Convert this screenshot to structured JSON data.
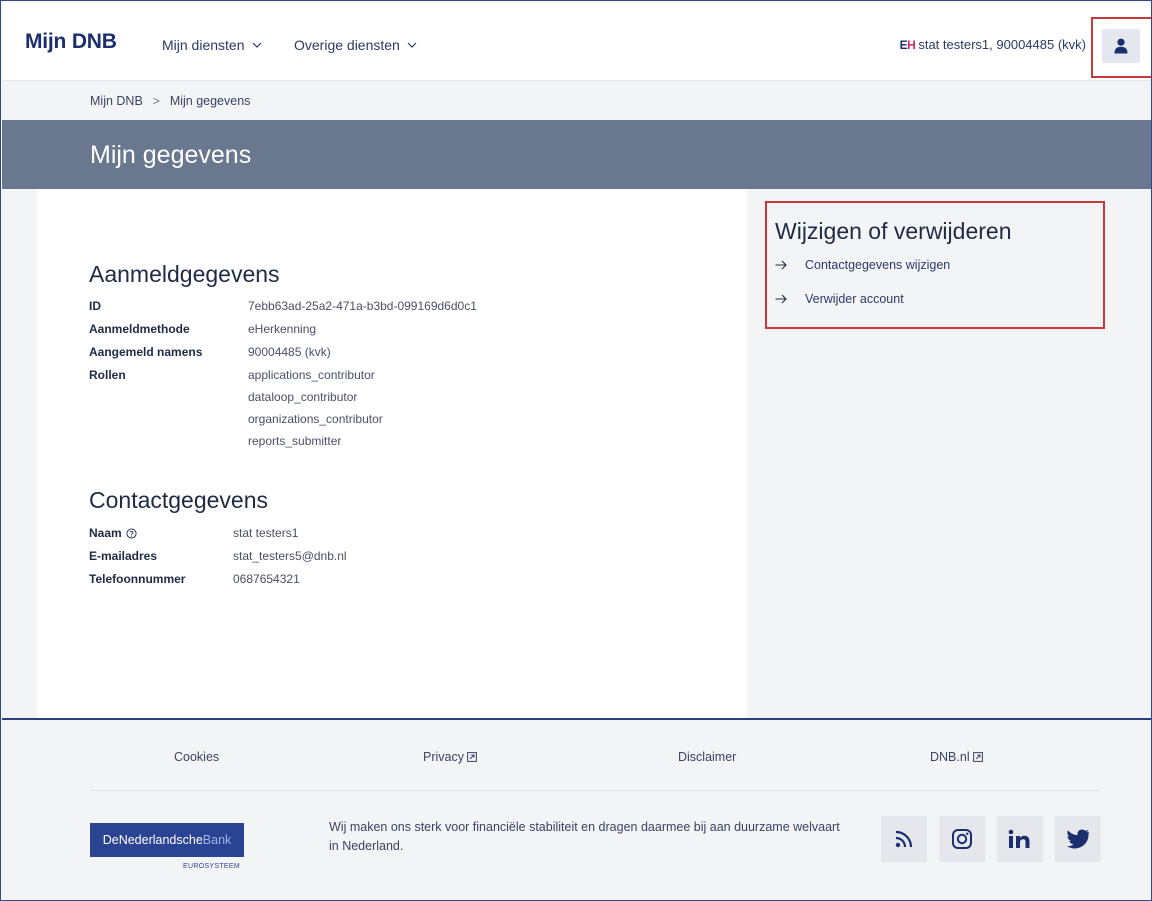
{
  "header": {
    "brand": "Mijn DNB",
    "nav": [
      {
        "label": "Mijn diensten"
      },
      {
        "label": "Overige diensten"
      }
    ],
    "user_label": "stat testers1, 90004485 (kvk)",
    "eh_logo_e": "E",
    "eh_logo_h": "H",
    "user_icon": "user-icon"
  },
  "breadcrumb": {
    "items": [
      "Mijn DNB",
      "Mijn gegevens"
    ],
    "separator": ">"
  },
  "page_title": "Mijn gegevens",
  "login_section": {
    "title": "Aanmeldgegevens",
    "rows": [
      {
        "key": "ID",
        "value": "7ebb63ad-25a2-471a-b3bd-099169d6d0c1"
      },
      {
        "key": "Aanmeldmethode",
        "value": "eHerkenning"
      },
      {
        "key": "Aangemeld namens",
        "value": "90004485 (kvk)"
      },
      {
        "key": "Rollen",
        "value": "applications_contributor"
      }
    ],
    "roles_extra": [
      "dataloop_contributor",
      "organizations_contributor",
      "reports_submitter"
    ]
  },
  "contact_section": {
    "title": "Contactgegevens",
    "rows": [
      {
        "key": "Naam",
        "value": "stat testers1"
      },
      {
        "key": "E-mailadres",
        "value": "stat_testers5@dnb.nl"
      },
      {
        "key": "Telefoonnummer",
        "value": "0687654321"
      }
    ],
    "help_icon": "help-circle-icon"
  },
  "side_panel": {
    "title": "Wijzigen of verwijderen",
    "links": [
      {
        "label": "Contactgegevens wijzigen"
      },
      {
        "label": "Verwijder account"
      }
    ]
  },
  "footer": {
    "links": [
      {
        "label": "Cookies",
        "external": false
      },
      {
        "label": "Privacy",
        "external": true
      },
      {
        "label": "Disclaimer",
        "external": false
      },
      {
        "label": "DNB.nl",
        "external": true
      }
    ],
    "logo_part1": "DeNederlandsche",
    "logo_part2": "Bank",
    "logo_sub": "EUROSYSTEEM",
    "text": "Wij maken ons sterk voor financiële stabiliteit en dragen daarmee bij aan duurzame welvaart in Nederland.",
    "social": [
      "rss-icon",
      "instagram-icon",
      "linkedin-icon",
      "twitter-icon"
    ]
  },
  "colors": {
    "brand": "#1b2f6e",
    "title_band": "#69788f",
    "highlight": "#c9393c",
    "footer_border": "#2d3f7a"
  }
}
